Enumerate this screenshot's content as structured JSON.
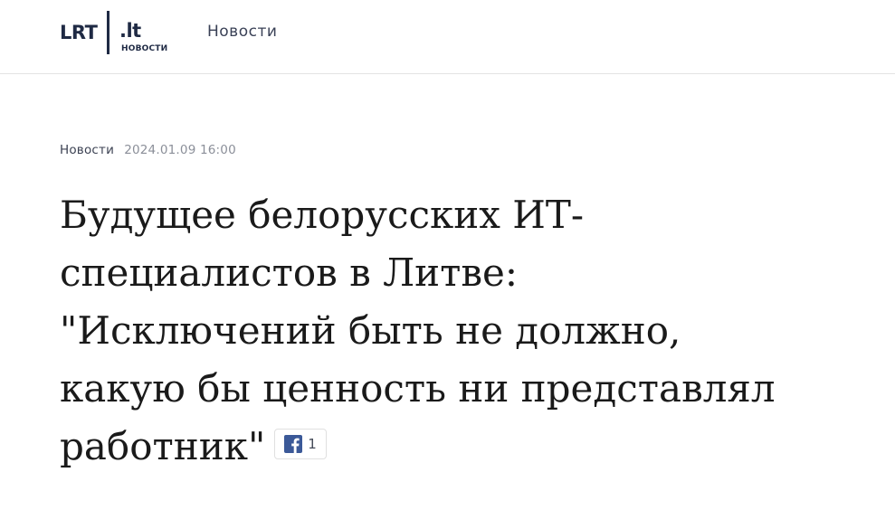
{
  "header": {
    "logo": {
      "brand": "LRT",
      "domain": ".lt",
      "section": "НОВОСТИ"
    },
    "nav_link": "Новости"
  },
  "article": {
    "category": "Новости",
    "datetime": "2024.01.09 16:00",
    "title_lines": [
      "Будущее белорусских ИТ-",
      "специалистов в Литве:",
      "\"Исключений быть не должно,",
      "какую бы ценность ни представлял",
      "работник\""
    ],
    "facebook_share": {
      "icon": "facebook-icon",
      "count": "1"
    }
  },
  "colors": {
    "brand_navy": "#1f2a44",
    "facebook_blue": "#3b5998"
  }
}
